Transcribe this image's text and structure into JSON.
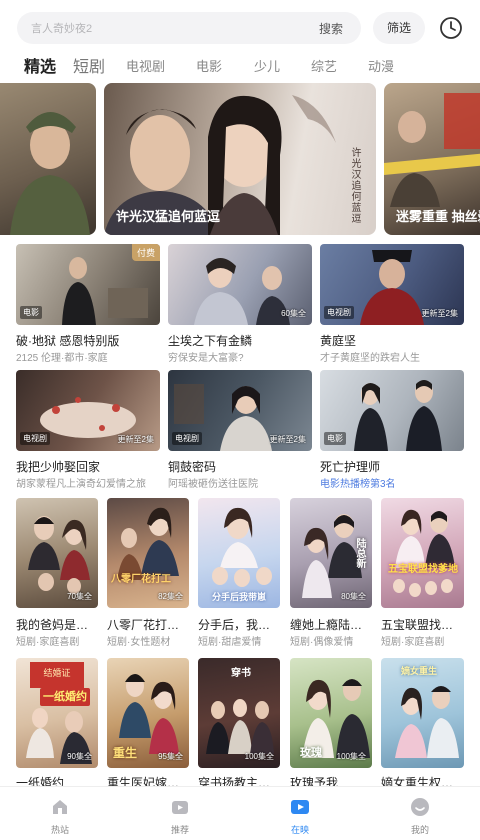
{
  "search": {
    "placeholder": "言人奇妙夜2",
    "search_label": "搜索",
    "filter_label": "筛选"
  },
  "tabs": [
    {
      "label": "精选",
      "active": true
    },
    {
      "label": "短剧"
    },
    {
      "label": "电视剧"
    },
    {
      "label": "电影"
    },
    {
      "label": "少儿"
    },
    {
      "label": "综艺"
    },
    {
      "label": "动漫"
    }
  ],
  "banner": {
    "cards": [
      {
        "caption": ""
      },
      {
        "caption": "许光汉猛追何蓝逗"
      },
      {
        "caption": "迷雾重重 抽丝剥茧"
      }
    ],
    "poster_text": "许光汉追何蓝逗",
    "active_dot": 0,
    "dot_count": 4
  },
  "row1": [
    {
      "title": "破·地狱 感恩特别版",
      "sub": "2125 伦理·都市·家庭",
      "type": "电影",
      "ep": "",
      "pay": "付费"
    },
    {
      "title": "尘埃之下有金鳞",
      "sub": "穷保安是大富豪?",
      "type": "",
      "ep": "60集全"
    },
    {
      "title": "黄庭坚",
      "sub": "才子黄庭坚的跌宕人生",
      "type": "电视剧",
      "ep": "更新至2集"
    }
  ],
  "row2": [
    {
      "title": "我把少帅娶回家",
      "sub": "胡家蒙程凡上演奇幻爱情之旅",
      "type": "电视剧",
      "ep": "更新至2集"
    },
    {
      "title": "铜鼓密码",
      "sub": "阿瑶被砸伤送往医院",
      "type": "电视剧",
      "ep": "更新至2集"
    },
    {
      "title": "死亡护理师",
      "sub": "电影热播榜第3名",
      "type": "电影",
      "ep": "",
      "rank": true
    }
  ],
  "row3": [
    {
      "title": "我的爸妈是…",
      "sub": "短剧·家庭喜剧",
      "ep": "70集全"
    },
    {
      "title": "八零厂花打…",
      "sub": "短剧·女性题材",
      "ep": "82集全",
      "poster": "八零厂花打工"
    },
    {
      "title": "分手后，我…",
      "sub": "短剧·甜虐爱情",
      "ep": "",
      "poster": "分手后我带崽"
    },
    {
      "title": "缠她上瘾陆…",
      "sub": "短剧·偶像爱情",
      "ep": "80集全",
      "poster": "陆总新"
    },
    {
      "title": "五宝联盟找…",
      "sub": "短剧·家庭喜剧",
      "ep": "",
      "poster": "五宝联盟找爹地"
    }
  ],
  "row4": [
    {
      "title": "一纸婚约",
      "ep": "90集全",
      "poster": "一纸婚约",
      "seal": "结婚证"
    },
    {
      "title": "重生医妃嫁…",
      "ep": "95集全",
      "poster": "重生"
    },
    {
      "title": "穿书扬教主…",
      "ep": "100集全",
      "poster": "穿书"
    },
    {
      "title": "玫瑰予我",
      "ep": "100集全",
      "poster": "玫瑰"
    },
    {
      "title": "嫡女重生权…",
      "ep": "95集全",
      "poster": "嫡女重生"
    }
  ],
  "nav": [
    {
      "label": "热站",
      "icon": "home-icon"
    },
    {
      "label": "推荐",
      "icon": "video-icon"
    },
    {
      "label": "在映",
      "icon": "play-icon",
      "active": true
    },
    {
      "label": "我的",
      "icon": "profile-icon"
    }
  ],
  "colors": {
    "accent": "#2e88f2",
    "pay": "#c9a266",
    "rank": "#4f7ce0"
  }
}
